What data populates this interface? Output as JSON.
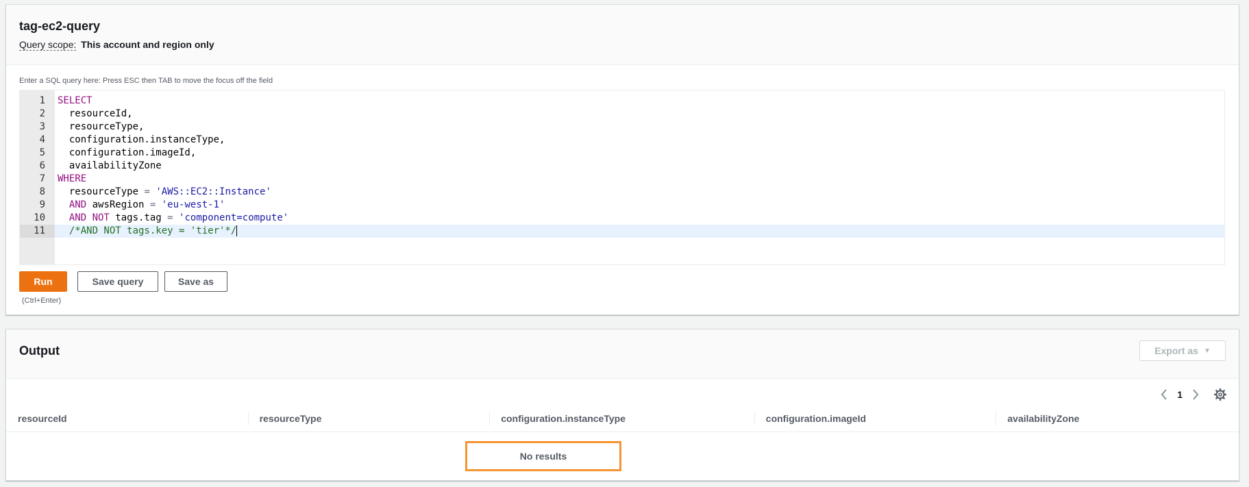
{
  "query": {
    "title": "tag-ec2-query",
    "scope_label": "Query scope:",
    "scope_value": "This account and region only",
    "editor_hint": "Enter a SQL query here: Press ESC then TAB to move the focus off the field",
    "lines": [
      {
        "num": "1",
        "segments": [
          {
            "t": "SELECT",
            "c": "kw"
          }
        ]
      },
      {
        "num": "2",
        "segments": [
          {
            "t": "  resourceId,",
            "c": ""
          }
        ]
      },
      {
        "num": "3",
        "segments": [
          {
            "t": "  resourceType,",
            "c": ""
          }
        ]
      },
      {
        "num": "4",
        "segments": [
          {
            "t": "  configuration.instanceType,",
            "c": ""
          }
        ]
      },
      {
        "num": "5",
        "segments": [
          {
            "t": "  configuration.imageId,",
            "c": ""
          }
        ]
      },
      {
        "num": "6",
        "segments": [
          {
            "t": "  availabilityZone",
            "c": ""
          }
        ]
      },
      {
        "num": "7",
        "segments": [
          {
            "t": "WHERE",
            "c": "kw"
          }
        ]
      },
      {
        "num": "8",
        "segments": [
          {
            "t": "  resourceType ",
            "c": ""
          },
          {
            "t": "=",
            "c": "op"
          },
          {
            "t": " ",
            "c": ""
          },
          {
            "t": "'AWS::EC2::Instance'",
            "c": "str"
          }
        ]
      },
      {
        "num": "9",
        "segments": [
          {
            "t": "  ",
            "c": ""
          },
          {
            "t": "AND",
            "c": "kw"
          },
          {
            "t": " awsRegion ",
            "c": ""
          },
          {
            "t": "=",
            "c": "op"
          },
          {
            "t": " ",
            "c": ""
          },
          {
            "t": "'eu-west-1'",
            "c": "str"
          }
        ]
      },
      {
        "num": "10",
        "segments": [
          {
            "t": "  ",
            "c": ""
          },
          {
            "t": "AND NOT",
            "c": "kw"
          },
          {
            "t": " tags.tag ",
            "c": ""
          },
          {
            "t": "=",
            "c": "op"
          },
          {
            "t": " ",
            "c": ""
          },
          {
            "t": "'component=compute'",
            "c": "str"
          }
        ]
      },
      {
        "num": "11",
        "segments": [
          {
            "t": "  /*AND NOT tags.key = 'tier'*/",
            "c": "cm"
          }
        ],
        "active": true
      }
    ],
    "buttons": {
      "run": "Run",
      "save_query": "Save query",
      "save_as": "Save as",
      "shortcut": "(Ctrl+Enter)"
    }
  },
  "output": {
    "title": "Output",
    "export_label": "Export as",
    "page": "1",
    "columns": [
      "resourceId",
      "resourceType",
      "configuration.instanceType",
      "configuration.imageId",
      "availabilityZone"
    ],
    "empty_message": "No results"
  },
  "colors": {
    "primary": "#ec7211",
    "highlight": "#f69432",
    "keyword": "#930f80",
    "string": "#1a1aa6"
  }
}
